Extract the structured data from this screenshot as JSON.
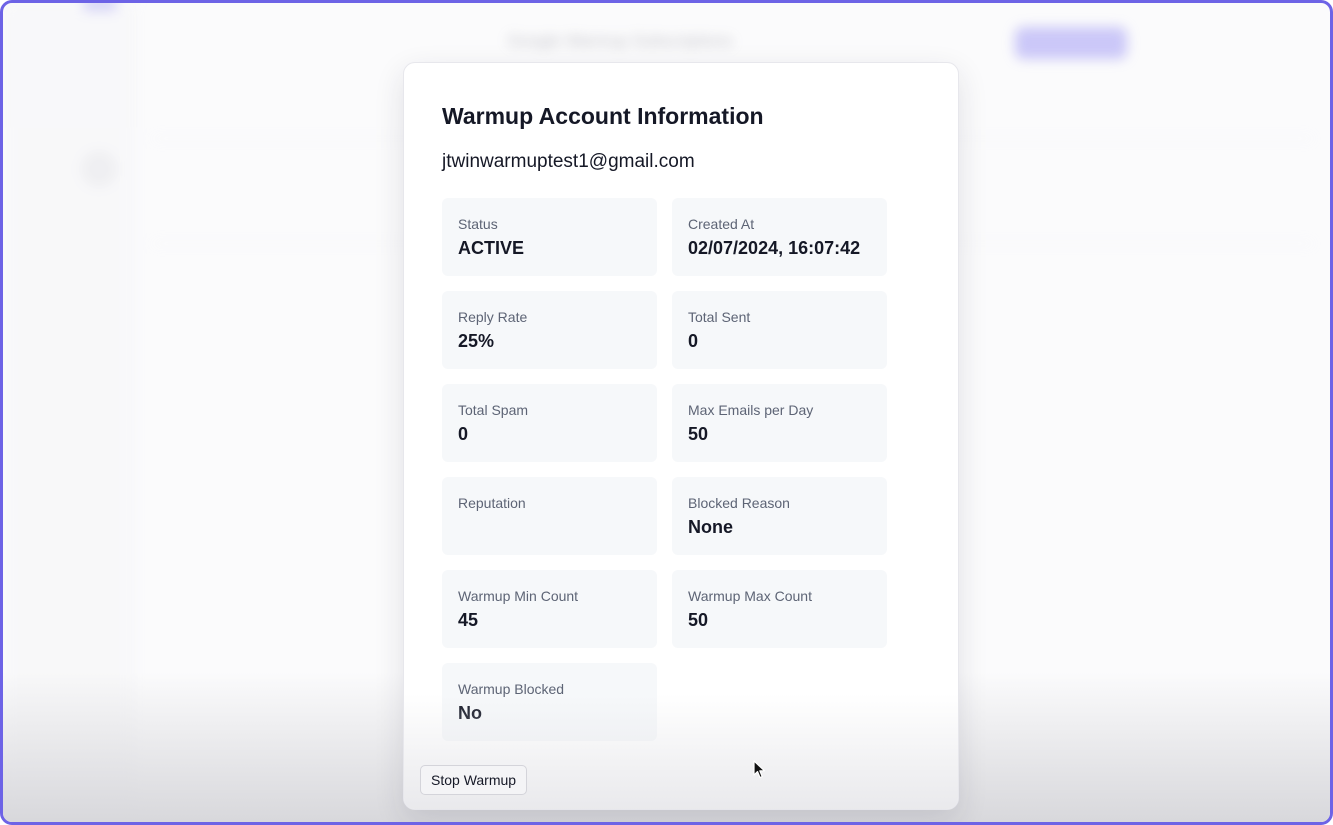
{
  "background": {
    "header_title": "Google Warmup Subscriptions",
    "accent_color": "#6d63e6"
  },
  "modal": {
    "title": "Warmup Account Information",
    "email": "jtwinwarmuptest1@gmail.com",
    "stats": [
      {
        "label": "Status",
        "value": "ACTIVE"
      },
      {
        "label": "Created At",
        "value": "02/07/2024, 16:07:42"
      },
      {
        "label": "Reply Rate",
        "value": "25%"
      },
      {
        "label": "Total Sent",
        "value": "0"
      },
      {
        "label": "Total Spam",
        "value": "0"
      },
      {
        "label": "Max Emails per Day",
        "value": "50"
      },
      {
        "label": "Reputation",
        "value": ""
      },
      {
        "label": "Blocked Reason",
        "value": "None"
      },
      {
        "label": "Warmup Min Count",
        "value": "45"
      },
      {
        "label": "Warmup Max Count",
        "value": "50"
      },
      {
        "label": "Warmup Blocked",
        "value": "No"
      }
    ],
    "stop_button_label": "Stop Warmup"
  },
  "cursor_icon": "mouse-pointer-icon"
}
